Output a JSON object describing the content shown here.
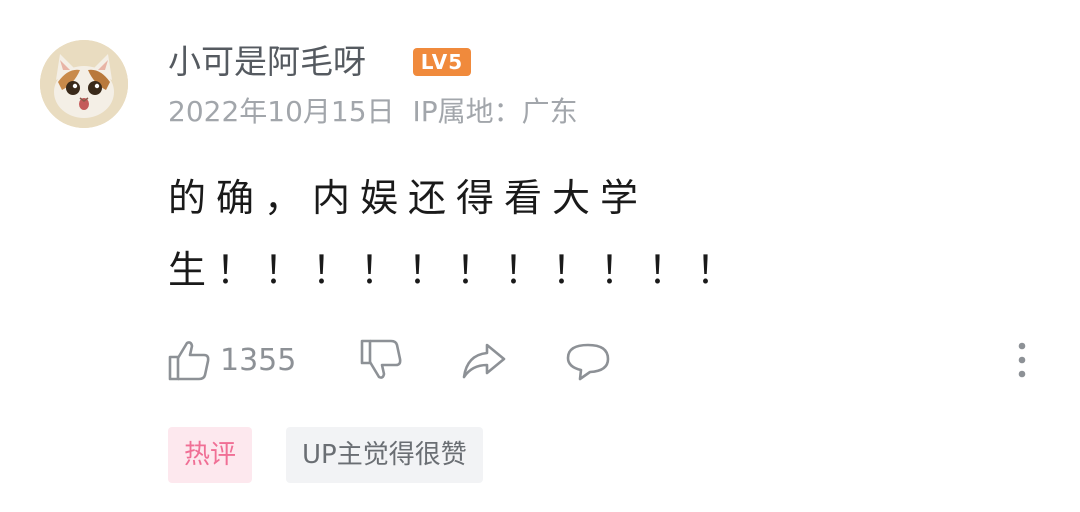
{
  "comment": {
    "username": "小可是阿毛呀",
    "level_badge": "LV5",
    "date": "2022年10月15日",
    "ip_location": "IP属地：广东",
    "text": "的确，内娱还得看大学生！！！！！！！！！！！",
    "likes": "1355",
    "tags": {
      "hot": "热评",
      "up_liked": "UP主觉得很赞"
    }
  },
  "colors": {
    "level_badge": "#f08a3c",
    "hot_tag_text": "#f06f95",
    "hot_tag_bg": "#fde8ee",
    "up_tag_bg": "#f2f3f5",
    "meta_text": "#a2a6ab"
  },
  "icons": {
    "avatar": "cat-avatar",
    "like": "thumbs-up-icon",
    "dislike": "thumbs-down-icon",
    "share": "share-arrow-icon",
    "reply": "chat-bubble-icon",
    "more": "more-vertical-icon"
  }
}
